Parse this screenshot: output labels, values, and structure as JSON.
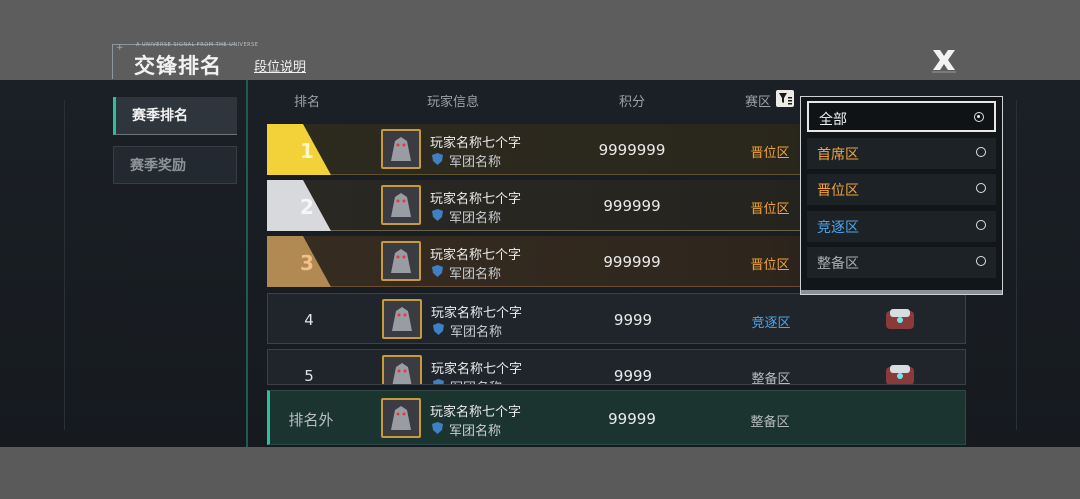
{
  "header": {
    "small_caption": "A UNIVERSE SIGNAL FROM THE UNIVERSE",
    "title": "交锋排名",
    "rules_link": "段位说明"
  },
  "sidebar": {
    "items": [
      {
        "label": "赛季排名",
        "active": true
      },
      {
        "label": "赛季奖励",
        "active": false
      }
    ]
  },
  "table": {
    "columns": {
      "rank": "排名",
      "player": "玩家信息",
      "score": "积分",
      "zone": "赛区"
    },
    "rows": [
      {
        "rank": "1",
        "name": "玩家名称七个字",
        "guild": "军团名称",
        "score": "9999999",
        "zone": "晋位区"
      },
      {
        "rank": "2",
        "name": "玩家名称七个字",
        "guild": "军团名称",
        "score": "999999",
        "zone": "晋位区"
      },
      {
        "rank": "3",
        "name": "玩家名称七个字",
        "guild": "军团名称",
        "score": "999999",
        "zone": "晋位区"
      },
      {
        "rank": "4",
        "name": "玩家名称七个字",
        "guild": "军团名称",
        "score": "9999",
        "zone": "竞逐区"
      },
      {
        "rank": "5",
        "name": "玩家名称七个字",
        "guild": "军团名称",
        "score": "9999",
        "zone": "整备区"
      }
    ],
    "self_row": {
      "rank": "排名外",
      "name": "玩家名称七个字",
      "guild": "军团名称",
      "score": "99999",
      "zone": "整备区"
    }
  },
  "zone_filter": {
    "selected": "全部",
    "options": [
      {
        "label": "全部",
        "color": "#f0f0f0"
      },
      {
        "label": "首席区",
        "color": "#f3a43a"
      },
      {
        "label": "晋位区",
        "color": "#f3a43a"
      },
      {
        "label": "竞逐区",
        "color": "#4ea6ec"
      },
      {
        "label": "整备区",
        "color": "#a8adb1"
      }
    ]
  },
  "colors": {
    "accent": "#27c3a0",
    "gold": "#f3d138",
    "silver": "#d8d9dc",
    "bronze": "#b08a52"
  }
}
